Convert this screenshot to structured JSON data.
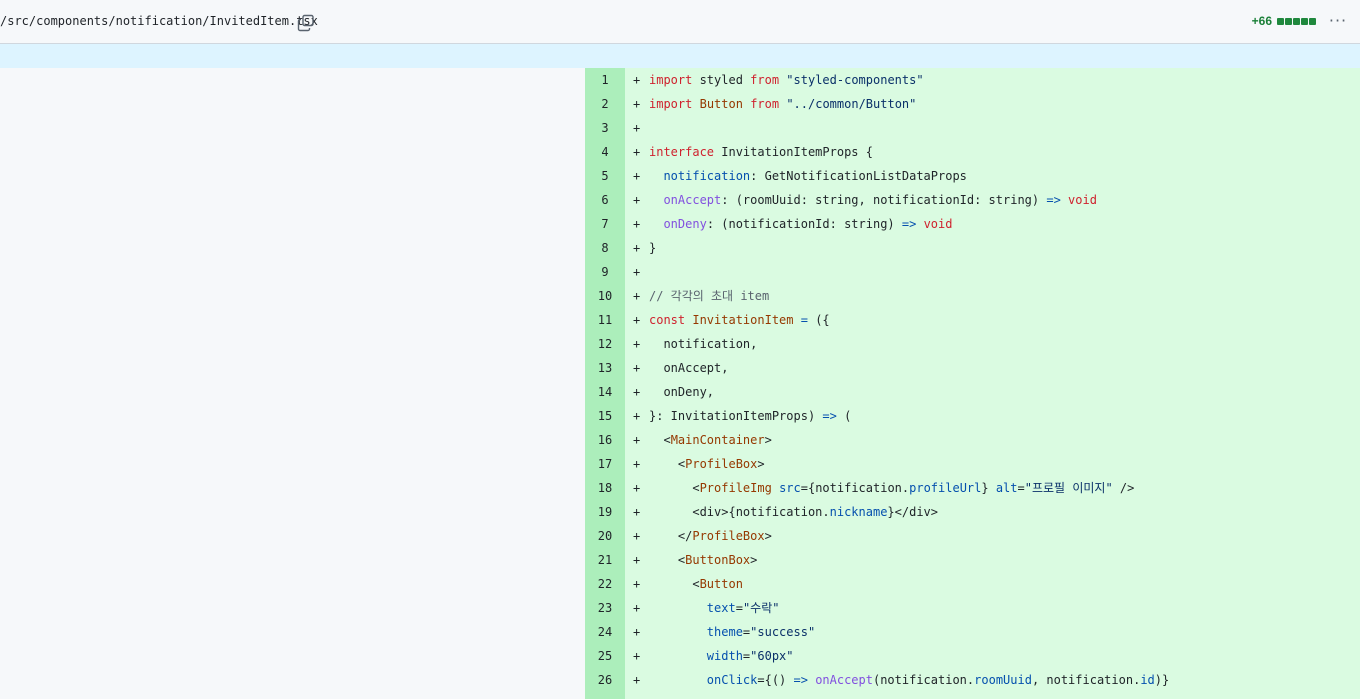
{
  "file_header": {
    "path": "/src/components/notification/InvitedItem.tsx",
    "copy_icon": "copy-icon",
    "diffstat": "+66",
    "diffstat_blocks": 5,
    "more_icon": "kebab-horizontal-icon",
    "more_text": "···"
  },
  "colors": {
    "added_line_bg": "#dafbe1",
    "added_gutter_bg": "#aceebb",
    "hunk_bg": "#ddf4ff",
    "keyword": "#cf222e",
    "string": "#0a3069",
    "property": "#0550ae",
    "function": "#8250df",
    "tag": "#953800"
  },
  "diff": {
    "marker": "+",
    "lines": [
      {
        "n": "1",
        "tokens": [
          [
            "kw",
            "import"
          ],
          [
            "pl",
            " styled "
          ],
          [
            "kw",
            "from"
          ],
          [
            "pl",
            " "
          ],
          [
            "str",
            "\"styled-components\""
          ]
        ]
      },
      {
        "n": "2",
        "tokens": [
          [
            "kw",
            "import"
          ],
          [
            "pl",
            " "
          ],
          [
            "tag",
            "Button"
          ],
          [
            "pl",
            " "
          ],
          [
            "kw",
            "from"
          ],
          [
            "pl",
            " "
          ],
          [
            "str",
            "\"../common/Button\""
          ]
        ]
      },
      {
        "n": "3",
        "tokens": []
      },
      {
        "n": "4",
        "tokens": [
          [
            "kw",
            "interface"
          ],
          [
            "pl",
            " InvitationItemProps {"
          ]
        ]
      },
      {
        "n": "5",
        "tokens": [
          [
            "pl",
            "  "
          ],
          [
            "prop",
            "notification"
          ],
          [
            "pl",
            ": GetNotificationListDataProps"
          ]
        ]
      },
      {
        "n": "6",
        "tokens": [
          [
            "pl",
            "  "
          ],
          [
            "fn",
            "onAccept"
          ],
          [
            "pl",
            ": (roomUuid: string, notificationId: string) "
          ],
          [
            "prop",
            "=>"
          ],
          [
            "pl",
            " "
          ],
          [
            "kw",
            "void"
          ]
        ]
      },
      {
        "n": "7",
        "tokens": [
          [
            "pl",
            "  "
          ],
          [
            "fn",
            "onDeny"
          ],
          [
            "pl",
            ": (notificationId: string) "
          ],
          [
            "prop",
            "=>"
          ],
          [
            "pl",
            " "
          ],
          [
            "kw",
            "void"
          ]
        ]
      },
      {
        "n": "8",
        "tokens": [
          [
            "pl",
            "}"
          ]
        ]
      },
      {
        "n": "9",
        "tokens": []
      },
      {
        "n": "10",
        "tokens": [
          [
            "cmt",
            "// 각각의 초대 item"
          ]
        ]
      },
      {
        "n": "11",
        "tokens": [
          [
            "kw",
            "const"
          ],
          [
            "pl",
            " "
          ],
          [
            "tag",
            "InvitationItem"
          ],
          [
            "pl",
            " "
          ],
          [
            "prop",
            "="
          ],
          [
            "pl",
            " ({"
          ]
        ]
      },
      {
        "n": "12",
        "tokens": [
          [
            "pl",
            "  notification,"
          ]
        ]
      },
      {
        "n": "13",
        "tokens": [
          [
            "pl",
            "  onAccept,"
          ]
        ]
      },
      {
        "n": "14",
        "tokens": [
          [
            "pl",
            "  onDeny,"
          ]
        ]
      },
      {
        "n": "15",
        "tokens": [
          [
            "pl",
            "}: InvitationItemProps) "
          ],
          [
            "prop",
            "=>"
          ],
          [
            "pl",
            " ("
          ]
        ]
      },
      {
        "n": "16",
        "tokens": [
          [
            "pl",
            "  <"
          ],
          [
            "tag",
            "MainContainer"
          ],
          [
            "pl",
            ">"
          ]
        ]
      },
      {
        "n": "17",
        "tokens": [
          [
            "pl",
            "    <"
          ],
          [
            "tag",
            "ProfileBox"
          ],
          [
            "pl",
            ">"
          ]
        ]
      },
      {
        "n": "18",
        "tokens": [
          [
            "pl",
            "      <"
          ],
          [
            "tag",
            "ProfileImg"
          ],
          [
            "pl",
            " "
          ],
          [
            "prop",
            "src"
          ],
          [
            "pl",
            "={notification."
          ],
          [
            "prop",
            "profileUrl"
          ],
          [
            "pl",
            "} "
          ],
          [
            "prop",
            "alt"
          ],
          [
            "pl",
            "="
          ],
          [
            "str",
            "\"프로필 이미지\""
          ],
          [
            "pl",
            " />"
          ]
        ]
      },
      {
        "n": "19",
        "tokens": [
          [
            "pl",
            "      <div>{notification."
          ],
          [
            "prop",
            "nickname"
          ],
          [
            "pl",
            "}</div>"
          ]
        ]
      },
      {
        "n": "20",
        "tokens": [
          [
            "pl",
            "    </"
          ],
          [
            "tag",
            "ProfileBox"
          ],
          [
            "pl",
            ">"
          ]
        ]
      },
      {
        "n": "21",
        "tokens": [
          [
            "pl",
            "    <"
          ],
          [
            "tag",
            "ButtonBox"
          ],
          [
            "pl",
            ">"
          ]
        ]
      },
      {
        "n": "22",
        "tokens": [
          [
            "pl",
            "      <"
          ],
          [
            "tag",
            "Button"
          ]
        ]
      },
      {
        "n": "23",
        "tokens": [
          [
            "pl",
            "        "
          ],
          [
            "prop",
            "text"
          ],
          [
            "pl",
            "="
          ],
          [
            "str",
            "\"수락\""
          ]
        ]
      },
      {
        "n": "24",
        "tokens": [
          [
            "pl",
            "        "
          ],
          [
            "prop",
            "theme"
          ],
          [
            "pl",
            "="
          ],
          [
            "str",
            "\"success\""
          ]
        ]
      },
      {
        "n": "25",
        "tokens": [
          [
            "pl",
            "        "
          ],
          [
            "prop",
            "width"
          ],
          [
            "pl",
            "="
          ],
          [
            "str",
            "\"60px\""
          ]
        ]
      },
      {
        "n": "26",
        "tokens": [
          [
            "pl",
            "        "
          ],
          [
            "prop",
            "onClick"
          ],
          [
            "pl",
            "={() "
          ],
          [
            "prop",
            "=>"
          ],
          [
            "pl",
            " "
          ],
          [
            "fn",
            "onAccept"
          ],
          [
            "pl",
            "(notification."
          ],
          [
            "prop",
            "roomUuid"
          ],
          [
            "pl",
            ", notification."
          ],
          [
            "prop",
            "id"
          ],
          [
            "pl",
            ")}"
          ]
        ]
      }
    ]
  }
}
